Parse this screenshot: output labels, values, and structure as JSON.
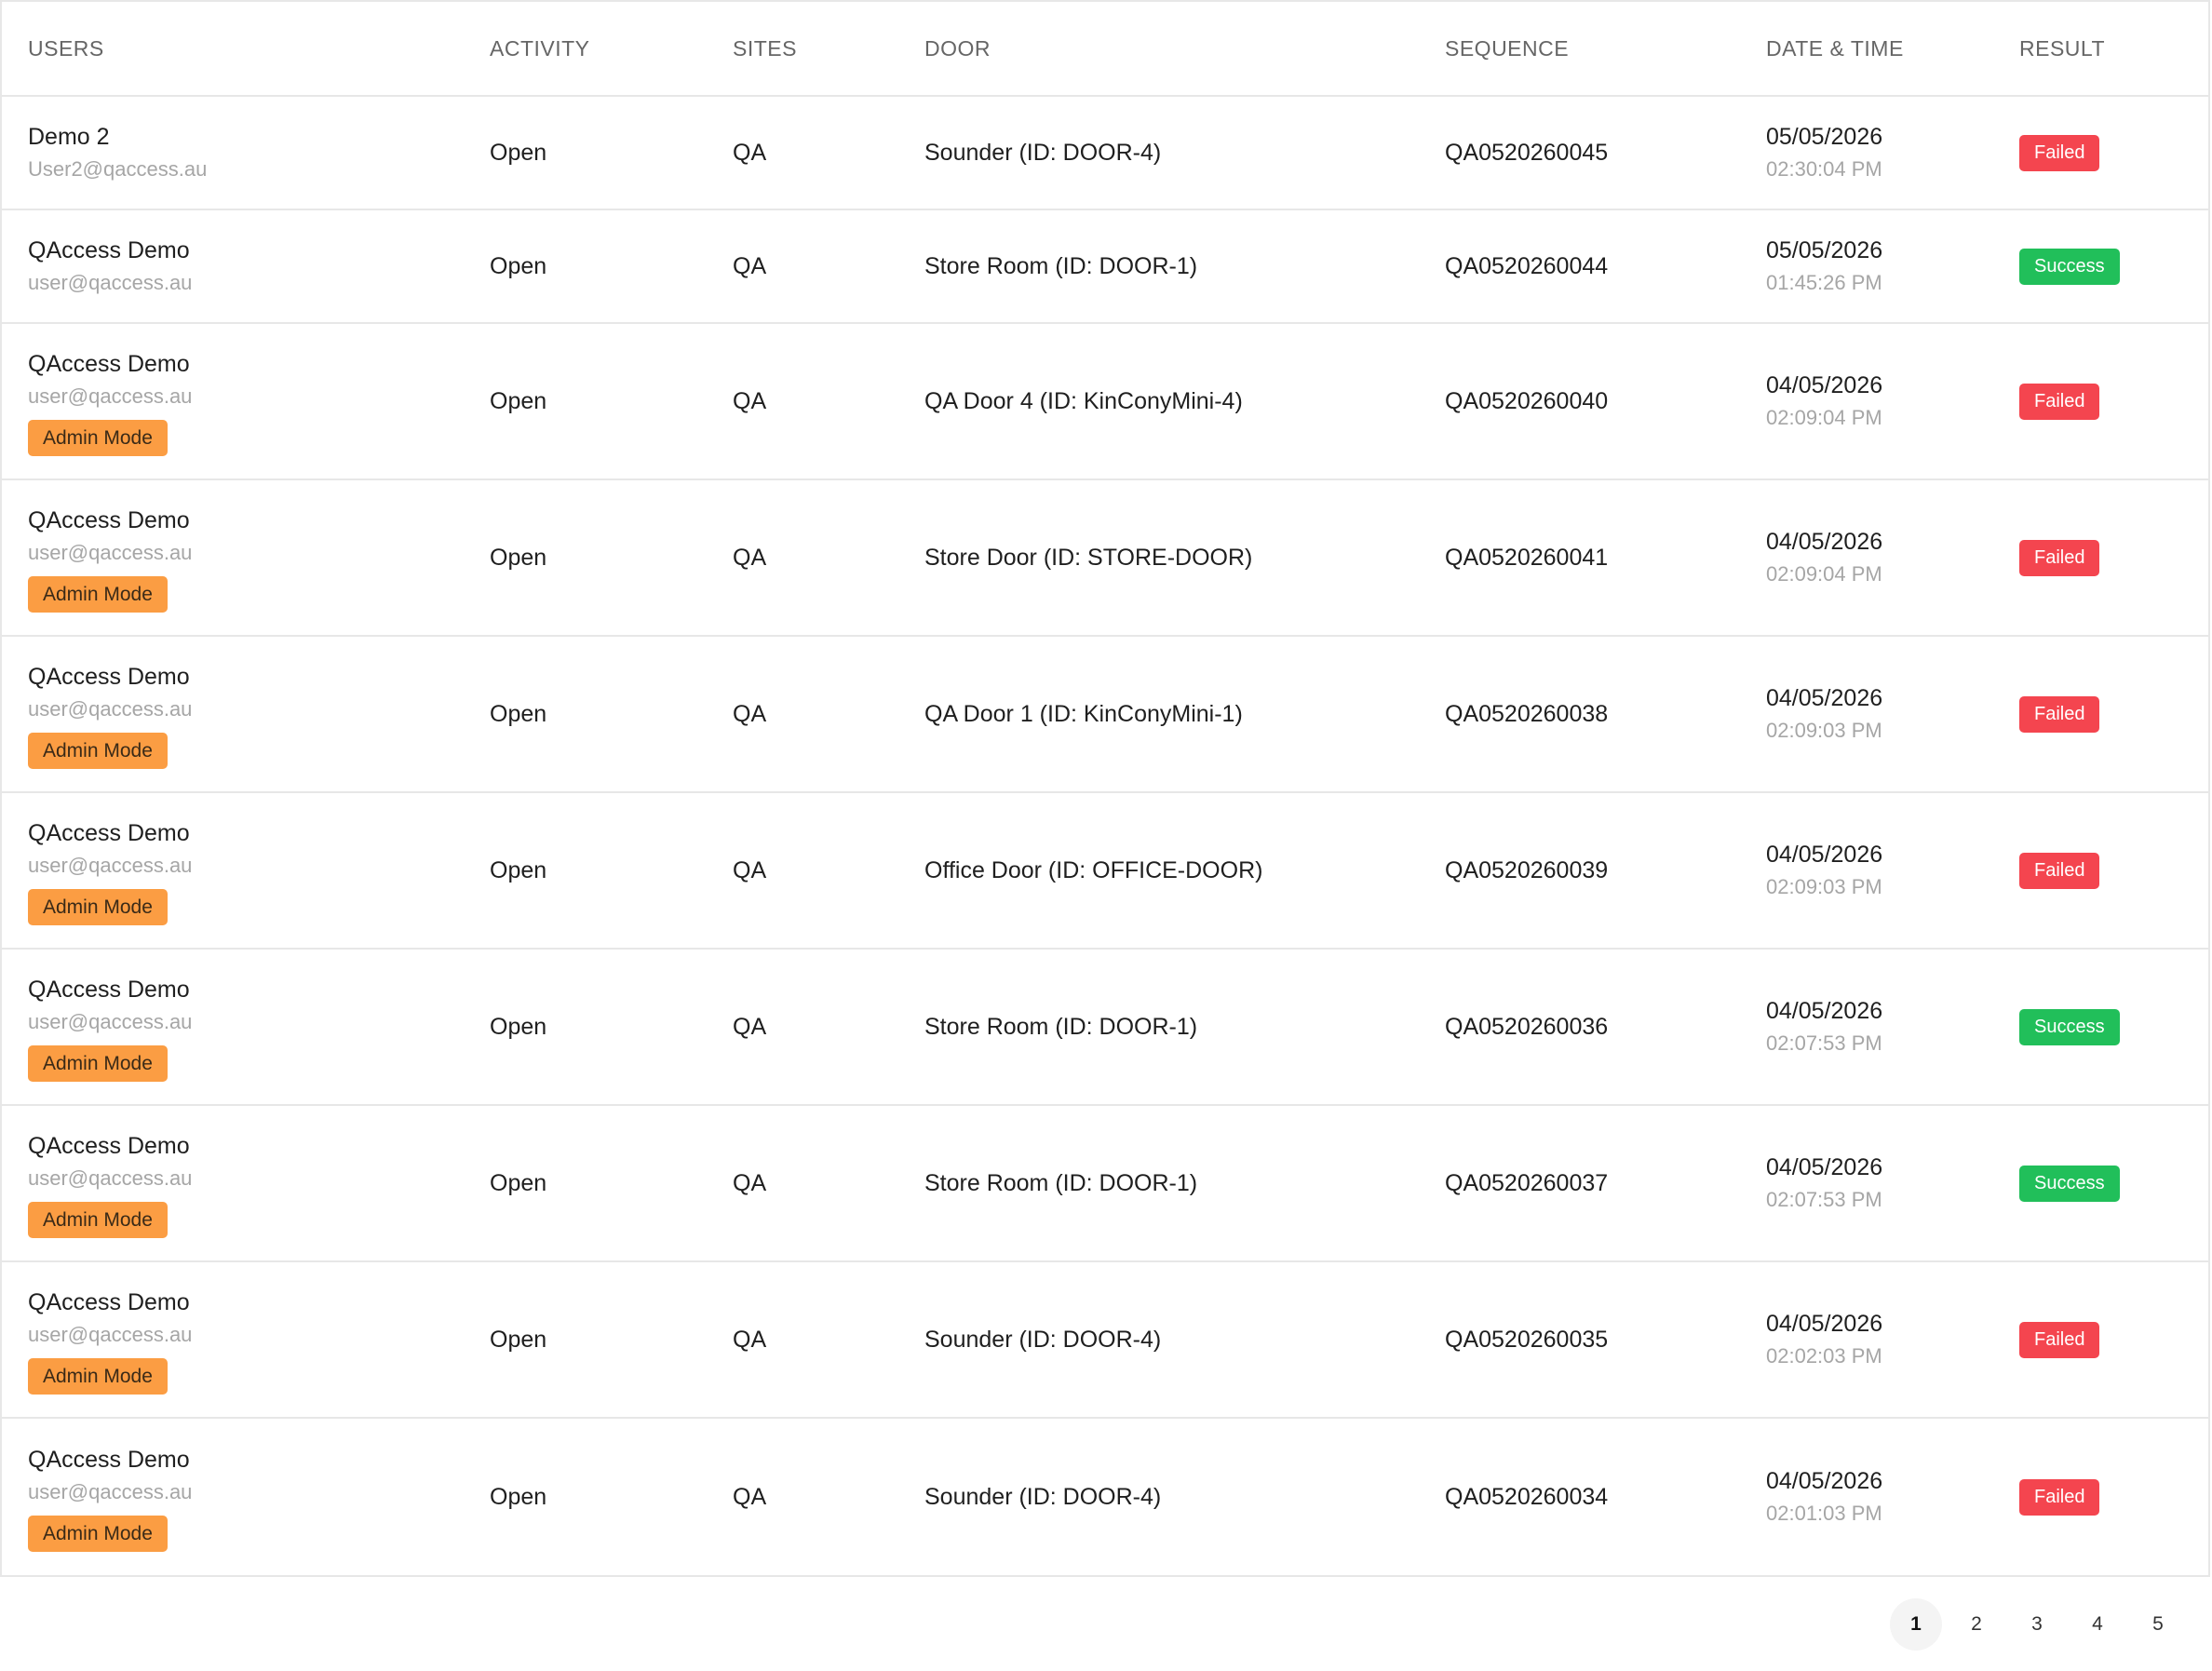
{
  "table": {
    "headers": {
      "users": "USERS",
      "activity": "ACTIVITY",
      "sites": "SITES",
      "door": "DOOR",
      "sequence": "SEQUENCE",
      "datetime": "DATE & TIME",
      "result": "RESULT"
    },
    "rows": [
      {
        "name": "Demo 2",
        "email": "User2@qaccess.au",
        "badge": "",
        "activity": "Open",
        "site": "QA",
        "door": "Sounder (ID: DOOR-4)",
        "sequence": "QA0520260045",
        "date": "05/05/2026",
        "time": "02:30:04 PM",
        "result": "Failed"
      },
      {
        "name": "QAccess Demo",
        "email": "user@qaccess.au",
        "badge": "",
        "activity": "Open",
        "site": "QA",
        "door": "Store Room (ID: DOOR-1)",
        "sequence": "QA0520260044",
        "date": "05/05/2026",
        "time": "01:45:26 PM",
        "result": "Success"
      },
      {
        "name": "QAccess Demo",
        "email": "user@qaccess.au",
        "badge": "Admin Mode",
        "activity": "Open",
        "site": "QA",
        "door": "QA Door 4 (ID: KinConyMini-4)",
        "sequence": "QA0520260040",
        "date": "04/05/2026",
        "time": "02:09:04 PM",
        "result": "Failed"
      },
      {
        "name": "QAccess Demo",
        "email": "user@qaccess.au",
        "badge": "Admin Mode",
        "activity": "Open",
        "site": "QA",
        "door": "Store Door (ID: STORE-DOOR)",
        "sequence": "QA0520260041",
        "date": "04/05/2026",
        "time": "02:09:04 PM",
        "result": "Failed"
      },
      {
        "name": "QAccess Demo",
        "email": "user@qaccess.au",
        "badge": "Admin Mode",
        "activity": "Open",
        "site": "QA",
        "door": "QA Door 1 (ID: KinConyMini-1)",
        "sequence": "QA0520260038",
        "date": "04/05/2026",
        "time": "02:09:03 PM",
        "result": "Failed"
      },
      {
        "name": "QAccess Demo",
        "email": "user@qaccess.au",
        "badge": "Admin Mode",
        "activity": "Open",
        "site": "QA",
        "door": "Office Door (ID: OFFICE-DOOR)",
        "sequence": "QA0520260039",
        "date": "04/05/2026",
        "time": "02:09:03 PM",
        "result": "Failed"
      },
      {
        "name": "QAccess Demo",
        "email": "user@qaccess.au",
        "badge": "Admin Mode",
        "activity": "Open",
        "site": "QA",
        "door": "Store Room (ID: DOOR-1)",
        "sequence": "QA0520260036",
        "date": "04/05/2026",
        "time": "02:07:53 PM",
        "result": "Success"
      },
      {
        "name": "QAccess Demo",
        "email": "user@qaccess.au",
        "badge": "Admin Mode",
        "activity": "Open",
        "site": "QA",
        "door": "Store Room (ID: DOOR-1)",
        "sequence": "QA0520260037",
        "date": "04/05/2026",
        "time": "02:07:53 PM",
        "result": "Success"
      },
      {
        "name": "QAccess Demo",
        "email": "user@qaccess.au",
        "badge": "Admin Mode",
        "activity": "Open",
        "site": "QA",
        "door": "Sounder (ID: DOOR-4)",
        "sequence": "QA0520260035",
        "date": "04/05/2026",
        "time": "02:02:03 PM",
        "result": "Failed"
      },
      {
        "name": "QAccess Demo",
        "email": "user@qaccess.au",
        "badge": "Admin Mode",
        "activity": "Open",
        "site": "QA",
        "door": "Sounder (ID: DOOR-4)",
        "sequence": "QA0520260034",
        "date": "04/05/2026",
        "time": "02:01:03 PM",
        "result": "Failed"
      }
    ]
  },
  "pagination": {
    "pages": [
      "1",
      "2",
      "3",
      "4",
      "5"
    ],
    "current": "1"
  },
  "colors": {
    "failed": "#f4454f",
    "success": "#21bf5a",
    "admin_badge": "#fb9d43"
  }
}
